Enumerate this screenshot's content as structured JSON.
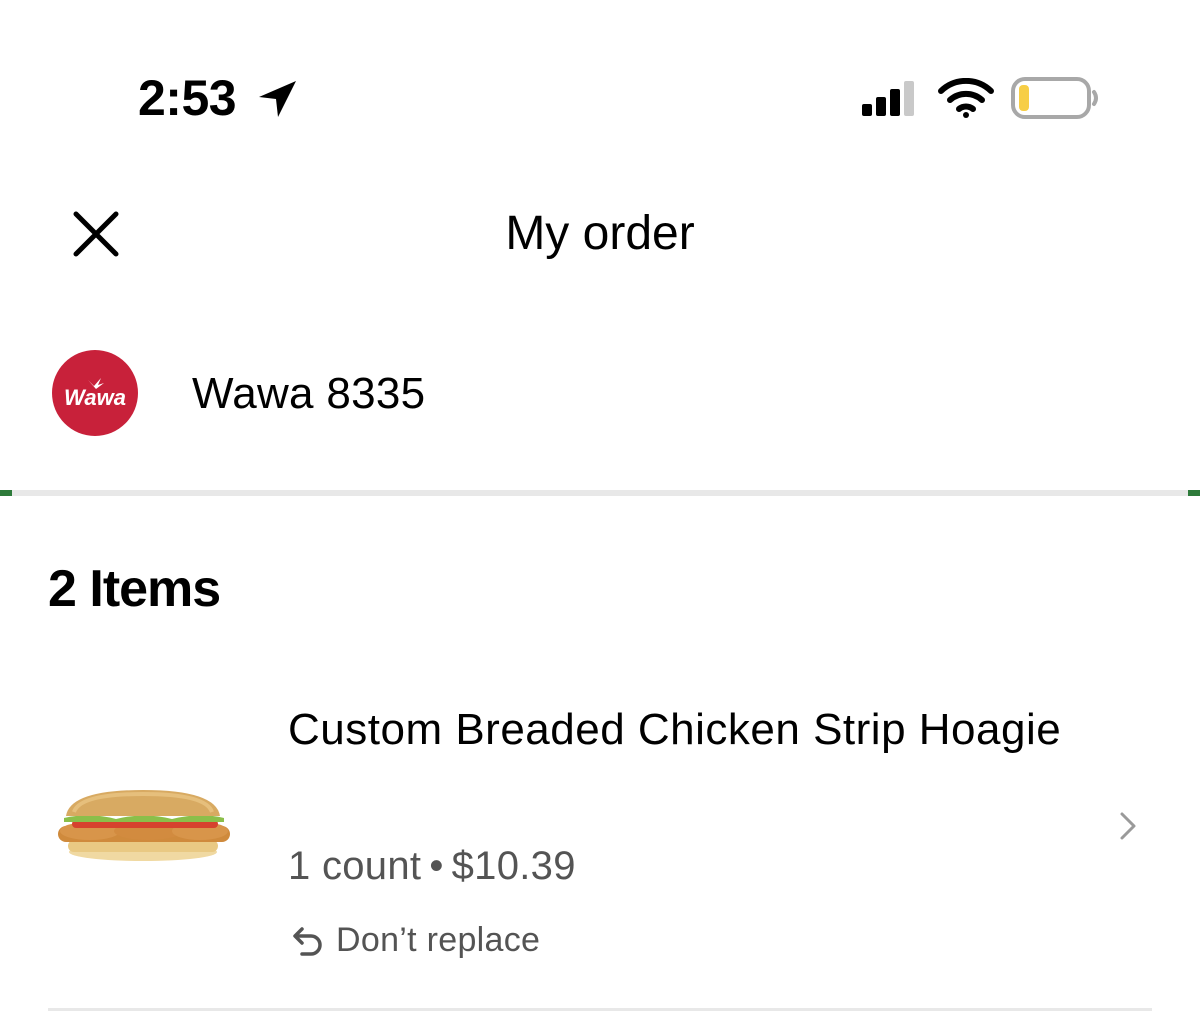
{
  "status_bar": {
    "time": "2:53",
    "icons": [
      "location-arrow-icon",
      "cellular-signal-icon",
      "wifi-icon",
      "battery-low-icon"
    ],
    "battery_color": "#f7ce46"
  },
  "header": {
    "title": "My order",
    "close_icon": "close-icon"
  },
  "store": {
    "name": "Wawa 8335",
    "logo_text": "Wawa",
    "logo_color": "#c8213a"
  },
  "items_section": {
    "heading": "2 Items",
    "items": [
      {
        "title": "Custom Breaded Chicken Strip Hoagie",
        "count": "1 count",
        "separator": "•",
        "price": "$10.39",
        "replace_label": "Don’t replace",
        "image": "chicken-hoagie-image"
      }
    ]
  },
  "colors": {
    "accent_green": "#2d7a3a",
    "secondary_text": "#545454",
    "divider": "#e8e8e8"
  }
}
